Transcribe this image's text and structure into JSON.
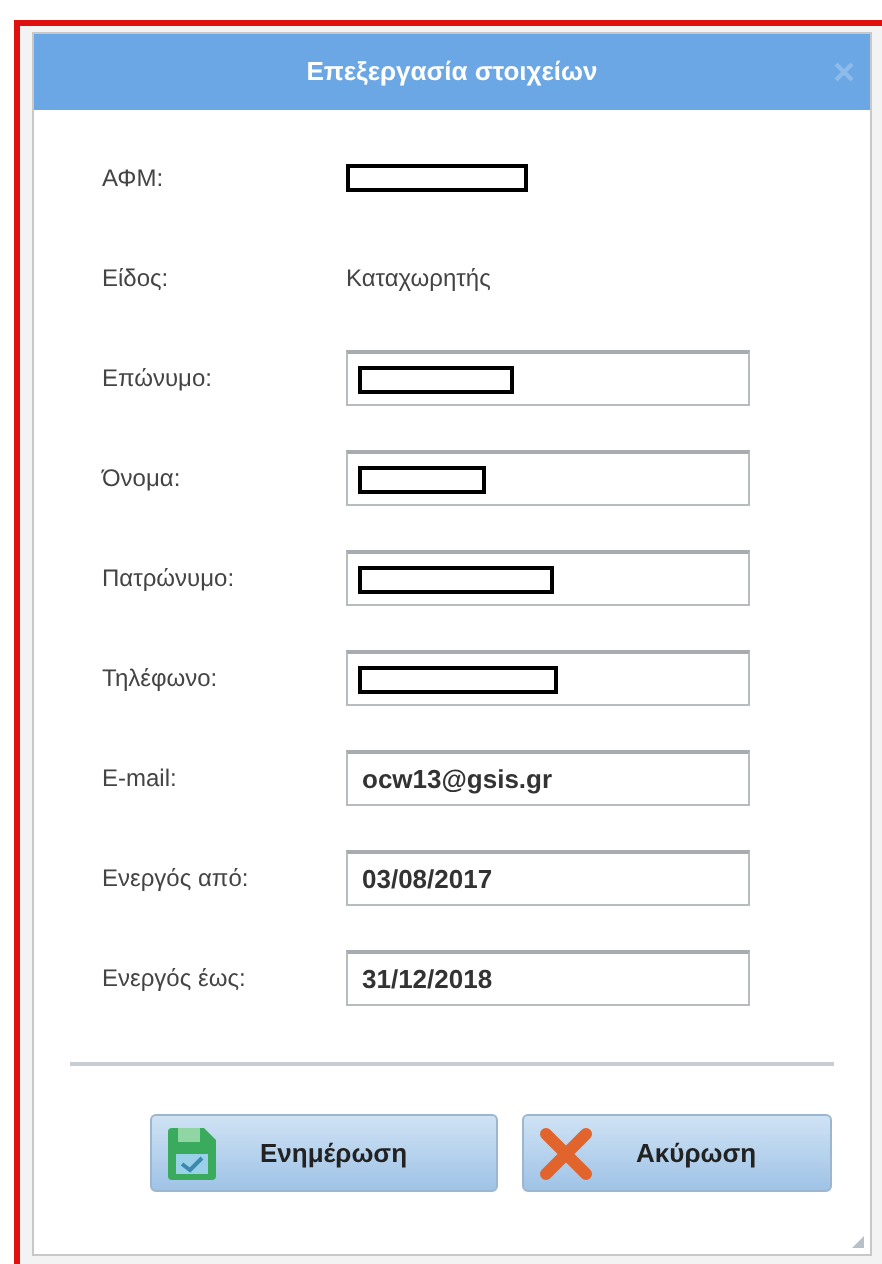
{
  "dialog": {
    "title": "Επεξεργασία στοιχείων"
  },
  "fields": [
    {
      "label": "ΑΦΜ:",
      "kind": "redacted-plain"
    },
    {
      "label": "Είδος:",
      "kind": "plain",
      "value": "Καταχωρητής"
    },
    {
      "label": "Επώνυμο:",
      "kind": "redacted-input"
    },
    {
      "label": "Όνομα:",
      "kind": "redacted-input"
    },
    {
      "label": "Πατρώνυμο:",
      "kind": "redacted-input"
    },
    {
      "label": "Τηλέφωνο:",
      "kind": "redacted-input"
    },
    {
      "label": "E-mail:",
      "kind": "input",
      "value": "ocw13@gsis.gr"
    },
    {
      "label": "Ενεργός από:",
      "kind": "input",
      "value": "03/08/2017"
    },
    {
      "label": "Ενεργός έως:",
      "kind": "input",
      "value": "31/12/2018"
    }
  ],
  "buttons": [
    {
      "label": "Ενημέρωση",
      "kind": "save"
    },
    {
      "label": "Ακύρωση",
      "kind": "cancel"
    }
  ]
}
